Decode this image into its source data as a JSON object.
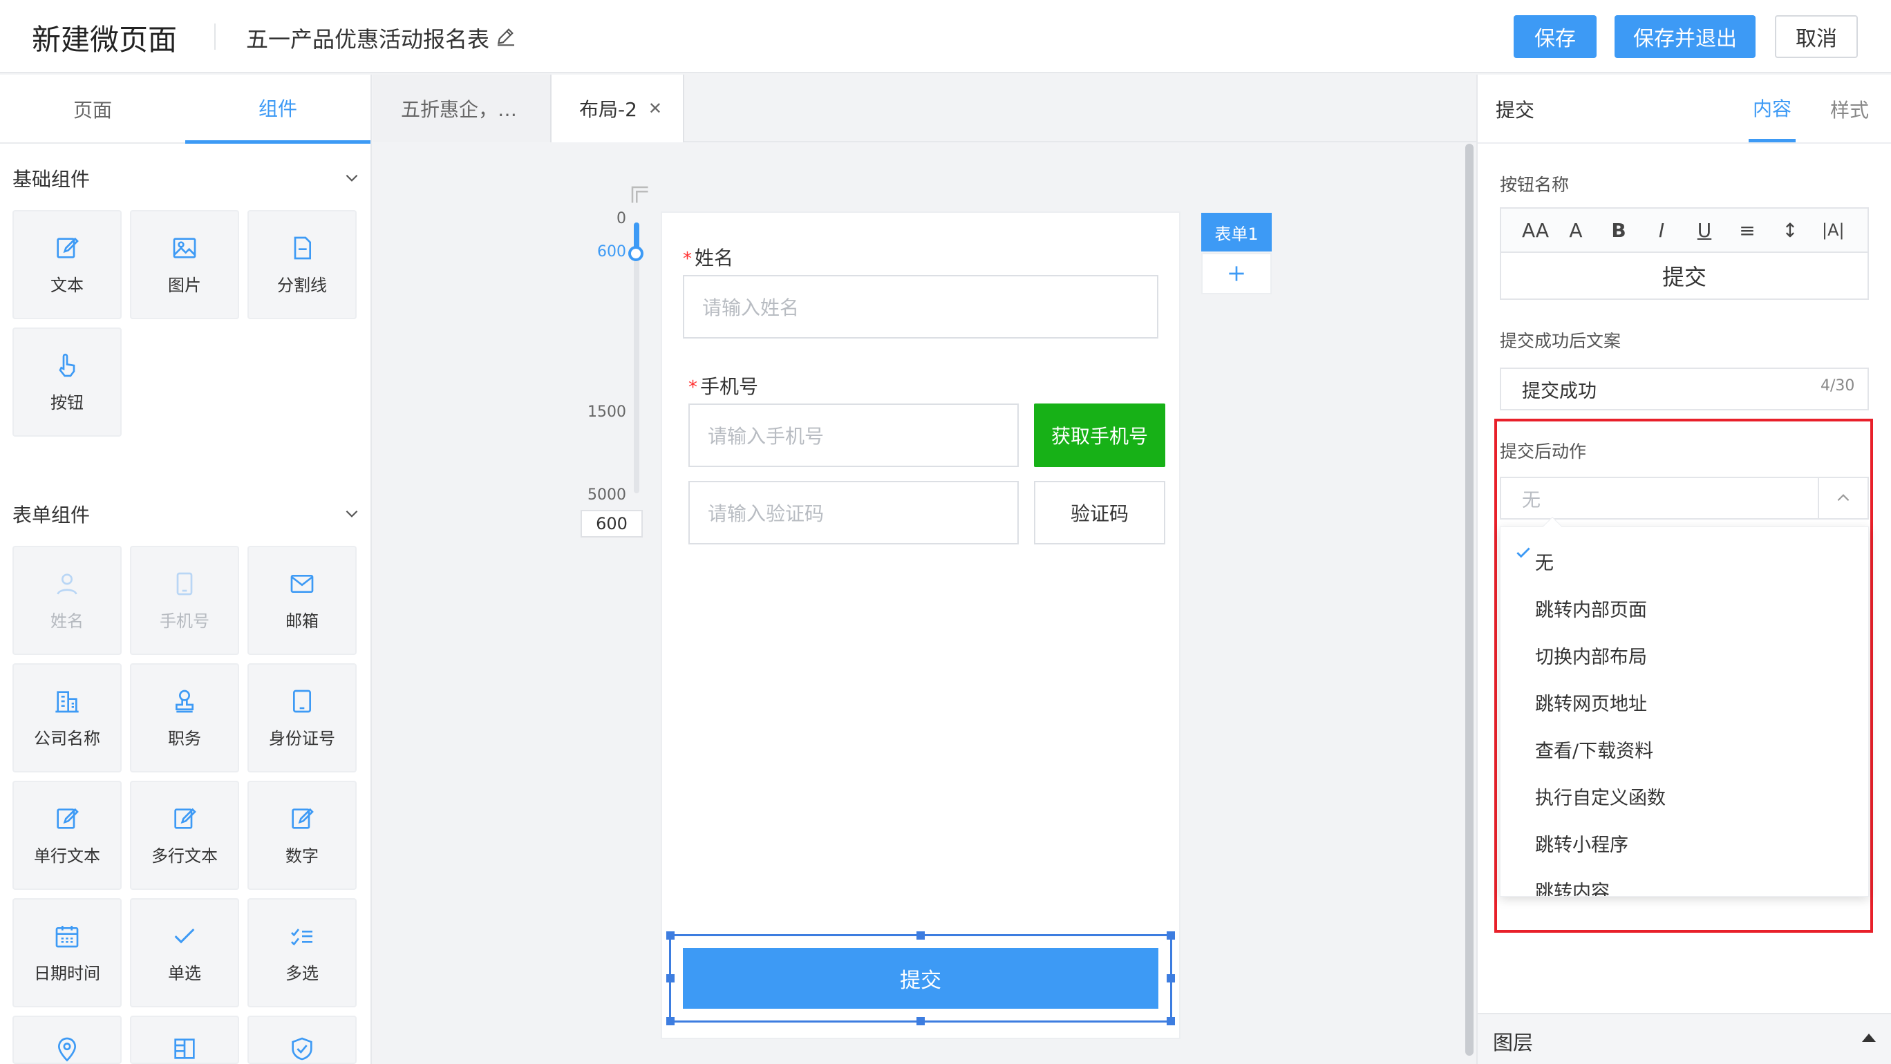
{
  "header": {
    "app_title": "新建微页面",
    "page_name": "五一产品优惠活动报名表",
    "save": "保存",
    "save_exit": "保存并退出",
    "cancel": "取消"
  },
  "left": {
    "tabs": [
      {
        "label": "页面"
      },
      {
        "label": "组件"
      }
    ],
    "basic_title": "基础组件",
    "basic": [
      {
        "label": "文本"
      },
      {
        "label": "图片"
      },
      {
        "label": "分割线"
      },
      {
        "label": "按钮"
      }
    ],
    "form_title": "表单组件",
    "form": [
      {
        "label": "姓名"
      },
      {
        "label": "手机号"
      },
      {
        "label": "邮箱"
      },
      {
        "label": "公司名称"
      },
      {
        "label": "职务"
      },
      {
        "label": "身份证号"
      },
      {
        "label": "单行文本"
      },
      {
        "label": "多行文本"
      },
      {
        "label": "数字"
      },
      {
        "label": "日期时间"
      },
      {
        "label": "单选"
      },
      {
        "label": "多选"
      }
    ]
  },
  "center": {
    "tabs": [
      {
        "label": "五折惠企，…"
      },
      {
        "label": "布局-2"
      }
    ],
    "ruler": {
      "v0": "0",
      "v600": "600",
      "v1500": "1500",
      "v5000": "5000",
      "input": "600"
    },
    "form": {
      "name_label": "姓名",
      "name_placeholder": "请输入姓名",
      "phone_label": "手机号",
      "phone_placeholder": "请输入手机号",
      "get_phone": "获取手机号",
      "code_placeholder": "请输入验证码",
      "code_button": "验证码",
      "submit": "提交"
    },
    "form_tag": "表单1"
  },
  "right": {
    "title": "提交",
    "tabs": [
      {
        "label": "内容"
      },
      {
        "label": "样式"
      }
    ],
    "button_name_label": "按钮名称",
    "toolbar": [
      "AA",
      "A",
      "B",
      "I",
      "U",
      "≡",
      "↕",
      "|A|"
    ],
    "button_name_value": "提交",
    "success_label": "提交成功后文案",
    "success_value": "提交成功",
    "success_count": "4/30",
    "action_label": "提交后动作",
    "action_placeholder": "无",
    "options": [
      {
        "label": "无"
      },
      {
        "label": "跳转内部页面"
      },
      {
        "label": "切换内部布局"
      },
      {
        "label": "跳转网页地址"
      },
      {
        "label": "查看/下载资料"
      },
      {
        "label": "执行自定义函数"
      },
      {
        "label": "跳转小程序"
      },
      {
        "label": "跳转内容"
      }
    ],
    "layers": "图层"
  },
  "colors": {
    "primary": "#3d9af5",
    "green": "#17b117",
    "highlight": "#e8202a"
  }
}
